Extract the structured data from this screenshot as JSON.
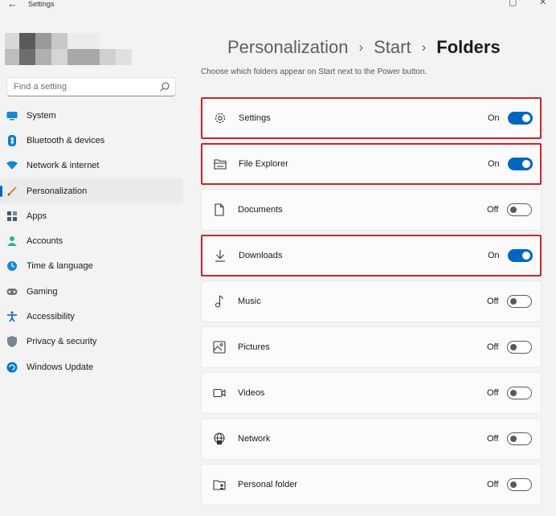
{
  "window": {
    "title": "Settings",
    "back_glyph": "←",
    "min_glyph": "▢",
    "close_glyph": "✕"
  },
  "search": {
    "placeholder": "Find a setting"
  },
  "sidebar": {
    "items": [
      {
        "label": "System",
        "icon": "system-icon",
        "color": "#0078d4"
      },
      {
        "label": "Bluetooth & devices",
        "icon": "bluetooth-icon",
        "color": "#0078d4"
      },
      {
        "label": "Network & internet",
        "icon": "wifi-icon",
        "color": "#0078d4"
      },
      {
        "label": "Personalization",
        "icon": "brush-icon",
        "color": "#e8833a",
        "active": true
      },
      {
        "label": "Apps",
        "icon": "apps-icon",
        "color": "#4a5a6a"
      },
      {
        "label": "Accounts",
        "icon": "accounts-icon",
        "color": "#2bb3a3"
      },
      {
        "label": "Time & language",
        "icon": "globe-clock-icon",
        "color": "#1a86d0"
      },
      {
        "label": "Gaming",
        "icon": "gamepad-icon",
        "color": "#6b7580"
      },
      {
        "label": "Accessibility",
        "icon": "accessibility-icon",
        "color": "#1a6fcf"
      },
      {
        "label": "Privacy & security",
        "icon": "shield-icon",
        "color": "#7a8590"
      },
      {
        "label": "Windows Update",
        "icon": "update-icon",
        "color": "#0078d4"
      }
    ]
  },
  "header": {
    "crumbs": [
      "Personalization",
      "Start",
      "Folders"
    ],
    "separator": "›",
    "subtitle": "Choose which folders appear on Start next to the Power button."
  },
  "folders": [
    {
      "label": "Settings",
      "state": "On",
      "on": true,
      "highlight": true,
      "icon": "gear-icon"
    },
    {
      "label": "File Explorer",
      "state": "On",
      "on": true,
      "highlight": true,
      "icon": "file-explorer-icon"
    },
    {
      "label": "Documents",
      "state": "Off",
      "on": false,
      "highlight": false,
      "icon": "document-icon"
    },
    {
      "label": "Downloads",
      "state": "On",
      "on": true,
      "highlight": true,
      "icon": "download-icon"
    },
    {
      "label": "Music",
      "state": "Off",
      "on": false,
      "highlight": false,
      "icon": "music-icon"
    },
    {
      "label": "Pictures",
      "state": "Off",
      "on": false,
      "highlight": false,
      "icon": "pictures-icon"
    },
    {
      "label": "Videos",
      "state": "Off",
      "on": false,
      "highlight": false,
      "icon": "video-icon"
    },
    {
      "label": "Network",
      "state": "Off",
      "on": false,
      "highlight": false,
      "icon": "network-globe-icon"
    },
    {
      "label": "Personal folder",
      "state": "Off",
      "on": false,
      "highlight": false,
      "icon": "personal-folder-icon"
    }
  ],
  "colors": {
    "accent": "#0067c0",
    "highlight_border": "#cc2229"
  }
}
